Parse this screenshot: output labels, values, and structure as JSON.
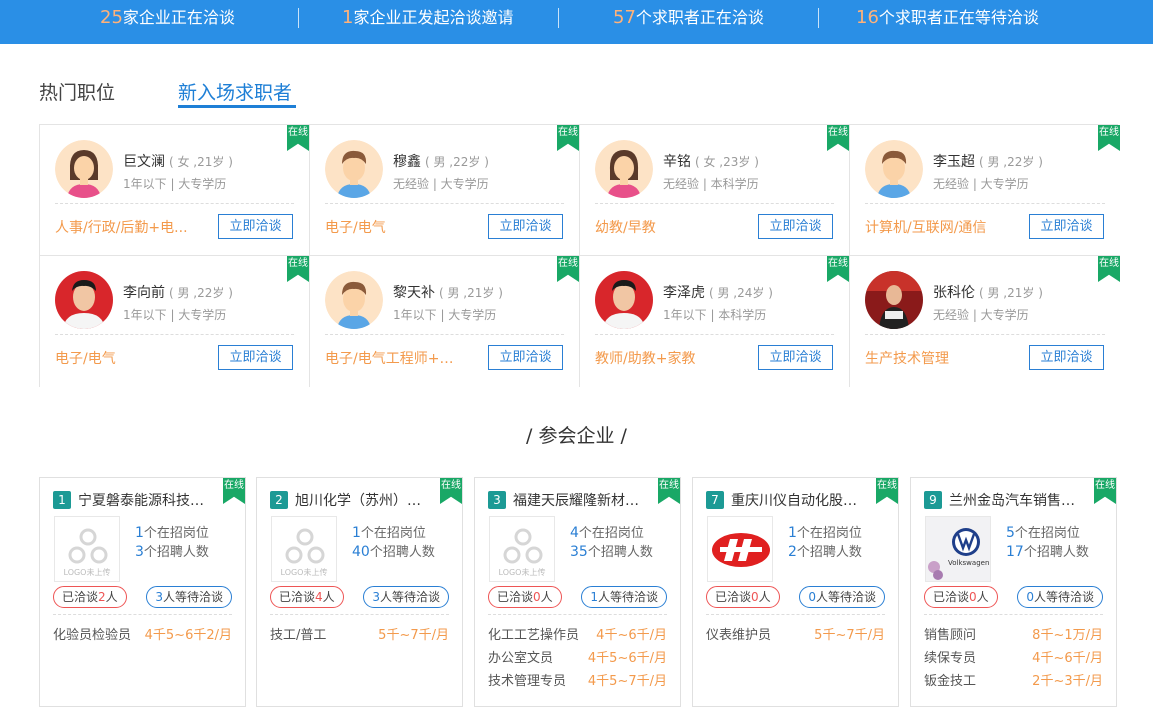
{
  "stats": [
    {
      "num": "25",
      "text": "家企业正在洽谈"
    },
    {
      "num": "1",
      "text": "家企业正发起洽谈邀请"
    },
    {
      "num": "57",
      "text": "个求职者正在洽谈"
    },
    {
      "num": "16",
      "text": "个求职者正在等待洽谈"
    }
  ],
  "tabs": [
    {
      "label": "热门职位",
      "active": false
    },
    {
      "label": "新入场求职者",
      "active": true
    }
  ],
  "online_label": "在线",
  "talk_button_label": "立即洽谈",
  "seekers": [
    {
      "name": "巨文澜",
      "meta": "( 女 ,21岁 )",
      "exp": "1年以下 | 大专学历",
      "job": "人事/行政/后勤+电...",
      "avatar": "female-avatar"
    },
    {
      "name": "穆鑫",
      "meta": "( 男 ,22岁 )",
      "exp": "无经验 | 大专学历",
      "job": "电子/电气",
      "avatar": "male-avatar"
    },
    {
      "name": "辛铭",
      "meta": "( 女 ,23岁 )",
      "exp": "无经验 | 本科学历",
      "job": "幼教/早教",
      "avatar": "female-avatar"
    },
    {
      "name": "李玉超",
      "meta": "( 男 ,22岁 )",
      "exp": "无经验 | 大专学历",
      "job": "计算机/互联网/通信",
      "avatar": "male-avatar"
    },
    {
      "name": "李向前",
      "meta": "( 男 ,22岁 )",
      "exp": "1年以下 | 大专学历",
      "job": "电子/电气",
      "avatar": "photo-red"
    },
    {
      "name": "黎天补",
      "meta": "( 男 ,21岁 )",
      "exp": "1年以下 | 大专学历",
      "job": "电子/电气工程师+电...",
      "avatar": "male-avatar"
    },
    {
      "name": "李泽虎",
      "meta": "( 男 ,24岁 )",
      "exp": "1年以下 | 本科学历",
      "job": "教师/助教+家教",
      "avatar": "photo-red"
    },
    {
      "name": "张科伦",
      "meta": "( 男 ,21岁 )",
      "exp": "无经验 | 大专学历",
      "job": "生产技术管理",
      "avatar": "photo-dark"
    }
  ],
  "section_title": "/  参会企业  /",
  "companies": [
    {
      "rank": "1",
      "name": "宁夏磐泰能源科技有...",
      "logo": "placeholder-logo",
      "logo_caption": "LOGO未上传",
      "positions": "1",
      "positions_text": "个在招岗位",
      "hires": "3",
      "hires_text": "个招聘人数",
      "talked": "2",
      "waiting": "3",
      "jobs": [
        {
          "title": "化验员检验员",
          "salary": "4千5~6千2/月"
        }
      ]
    },
    {
      "rank": "2",
      "name": "旭川化学（苏州）有...",
      "logo": "placeholder-logo",
      "logo_caption": "LOGO未上传",
      "positions": "1",
      "positions_text": "个在招岗位",
      "hires": "40",
      "hires_text": "个招聘人数",
      "talked": "4",
      "waiting": "3",
      "jobs": [
        {
          "title": "技工/普工",
          "salary": "5千~7千/月"
        }
      ]
    },
    {
      "rank": "3",
      "name": "福建天辰耀隆新材料...",
      "logo": "placeholder-logo",
      "logo_caption": "LOGO未上传",
      "positions": "4",
      "positions_text": "个在招岗位",
      "hires": "35",
      "hires_text": "个招聘人数",
      "talked": "0",
      "waiting": "1",
      "jobs": [
        {
          "title": "化工工艺操作员",
          "salary": "4千~6千/月"
        },
        {
          "title": "办公室文员",
          "salary": "4千5~6千/月"
        },
        {
          "title": "技术管理专员",
          "salary": "4千5~7千/月"
        }
      ]
    },
    {
      "rank": "7",
      "name": "重庆川仪自动化股份...",
      "logo": "chuanyi-logo",
      "logo_caption": "",
      "positions": "1",
      "positions_text": "个在招岗位",
      "hires": "2",
      "hires_text": "个招聘人数",
      "talked": "0",
      "waiting": "0",
      "jobs": [
        {
          "title": "仪表维护员",
          "salary": "5千~7千/月"
        }
      ]
    },
    {
      "rank": "9",
      "name": "兰州金岛汽车销售有...",
      "logo": "volkswagen-logo",
      "logo_caption": "Volkswagen",
      "positions": "5",
      "positions_text": "个在招岗位",
      "hires": "17",
      "hires_text": "个招聘人数",
      "talked": "0",
      "waiting": "0",
      "jobs": [
        {
          "title": "销售顾问",
          "salary": "8千~1万/月"
        },
        {
          "title": "续保专员",
          "salary": "4千~6千/月"
        },
        {
          "title": "钣金技工",
          "salary": "2千~3千/月"
        }
      ]
    }
  ],
  "talked_prefix": "已洽谈",
  "talked_suffix": "人",
  "waiting_suffix": "人等待洽谈",
  "colors": {
    "primary": "#2a8fe6",
    "accent_orange": "#f39a4c",
    "online_green": "#19a866",
    "rank_teal": "#1c9a95",
    "talked_red": "#e55555"
  }
}
